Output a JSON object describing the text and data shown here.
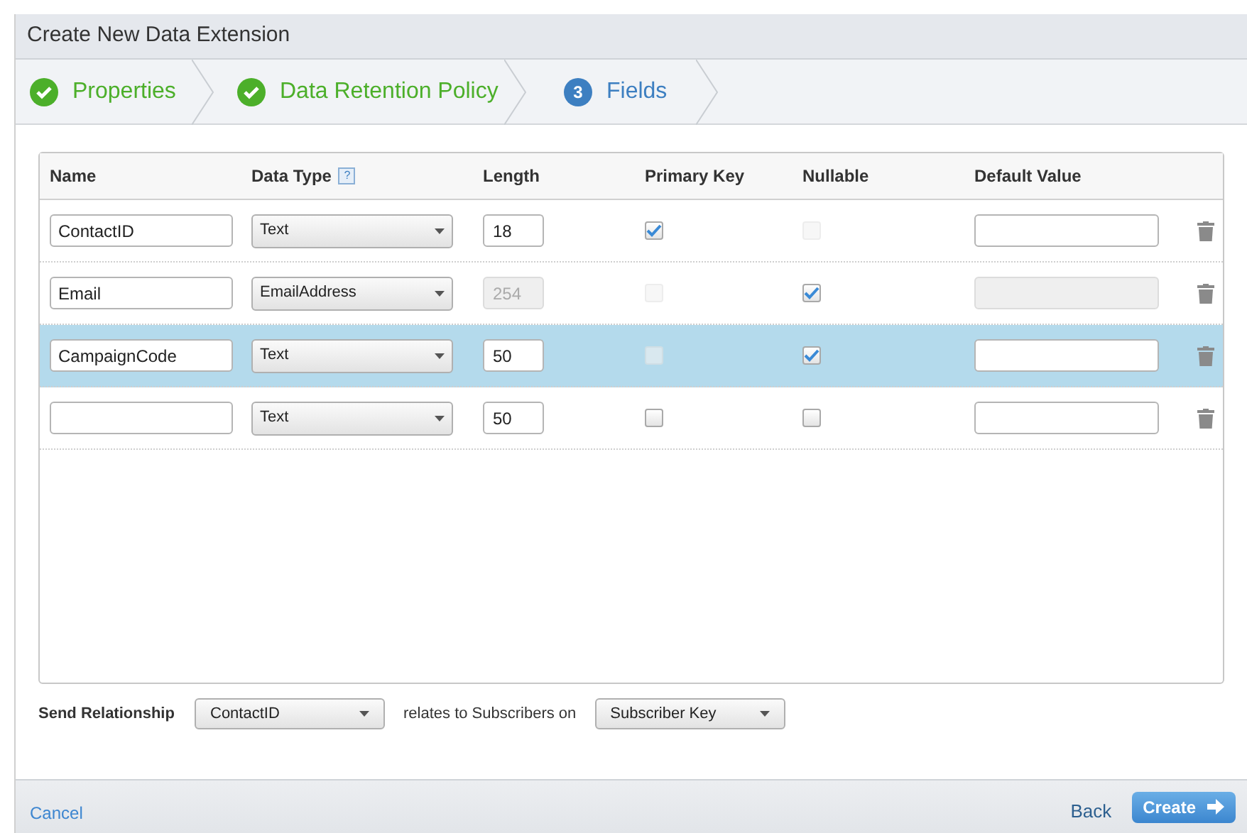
{
  "window": {
    "title": "Create New Data Extension"
  },
  "steps": [
    {
      "label": "Properties",
      "done": true
    },
    {
      "label": "Data Retention Policy",
      "done": true
    },
    {
      "label": "Fields",
      "done": false,
      "number": "3"
    }
  ],
  "table": {
    "columns": [
      {
        "label": "Name"
      },
      {
        "label": "Data Type",
        "help": "?"
      },
      {
        "label": "Length"
      },
      {
        "label": "Primary Key"
      },
      {
        "label": "Nullable"
      },
      {
        "label": "Default Value"
      }
    ],
    "rows": [
      {
        "selected": false,
        "name": "ContactID",
        "data_type": "Text",
        "length": {
          "value": "18",
          "disabled": false
        },
        "primary_key": {
          "checked": true,
          "disabled": false
        },
        "nullable": {
          "checked": false,
          "disabled": true
        },
        "default_value": {
          "disabled": false
        }
      },
      {
        "selected": false,
        "name": "Email",
        "data_type": "EmailAddress",
        "length": {
          "value": "254",
          "disabled": true
        },
        "primary_key": {
          "checked": false,
          "disabled": true
        },
        "nullable": {
          "checked": true,
          "disabled": false
        },
        "default_value": {
          "disabled": true
        }
      },
      {
        "selected": true,
        "name": "CampaignCode",
        "data_type": "Text",
        "length": {
          "value": "50",
          "disabled": false
        },
        "primary_key": {
          "checked": false,
          "disabled": true
        },
        "nullable": {
          "checked": true,
          "disabled": false
        },
        "default_value": {
          "disabled": false
        }
      },
      {
        "selected": false,
        "data_type": "Text",
        "length": {
          "value": "50",
          "disabled": false
        },
        "primary_key": {
          "checked": false,
          "disabled": false
        },
        "nullable": {
          "checked": false,
          "disabled": false
        },
        "default_value": {
          "disabled": false
        }
      }
    ]
  },
  "send_relationship": {
    "label": "Send Relationship",
    "field": "ContactID",
    "relates_text": "relates to Subscribers on",
    "subscriber_field": "Subscriber Key"
  },
  "footer": {
    "cancel": "Cancel",
    "back": "Back",
    "create": "Create"
  }
}
